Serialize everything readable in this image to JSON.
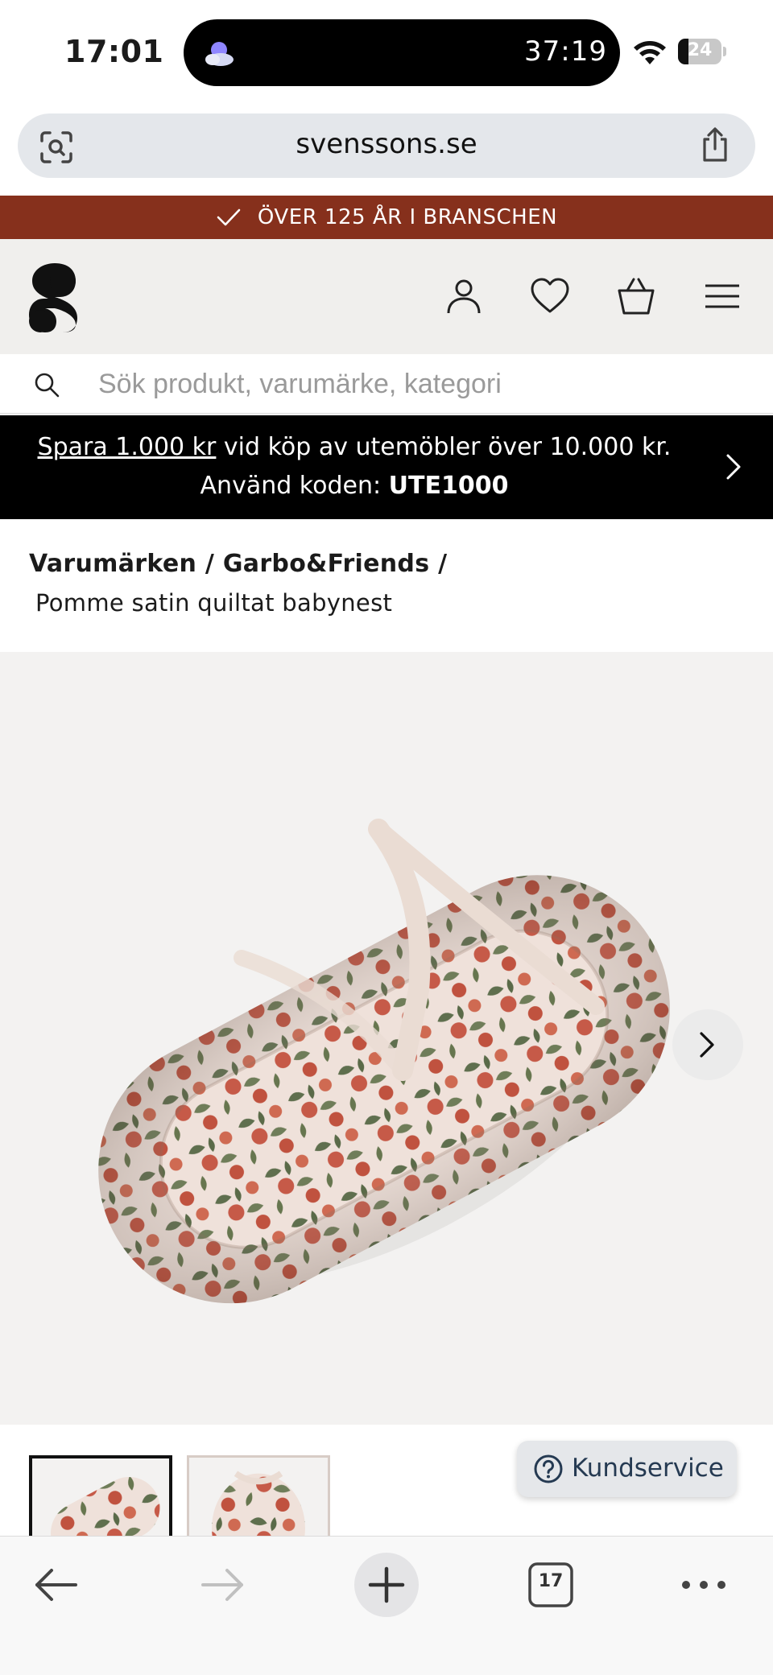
{
  "status_bar": {
    "time": "17:01",
    "live_activity_timer": "37:19",
    "battery_level": "24",
    "battery_fraction": 0.24
  },
  "browser": {
    "url": "svenssons.se"
  },
  "ribbon": {
    "text": "ÖVER 125 ÅR I BRANSCHEN"
  },
  "search": {
    "placeholder": "Sök produkt, varumärke, kategori",
    "value": ""
  },
  "offer": {
    "link_text": "Spara 1.000 kr",
    "text_rest": " vid köp av utemöbler över 10.000 kr.",
    "code_label": "Använd koden: ",
    "code": "UTE1000"
  },
  "breadcrumb": {
    "path": "Varumärken / Garbo&Friends /",
    "current": "Pomme satin quiltat babynest"
  },
  "kundservice": {
    "label": "Kundservice"
  },
  "toolbar": {
    "tab_count": "17"
  },
  "colors": {
    "ribbon_bg": "#86301c",
    "header_bg": "#f0efed",
    "offer_bg": "#000000",
    "kundservice_text": "#253a52"
  }
}
